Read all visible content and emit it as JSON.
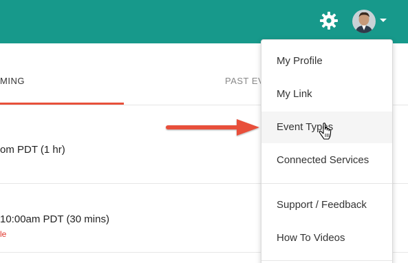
{
  "header": {
    "bg_color": "#17998b",
    "gear_icon": "gear-icon",
    "avatar": "user-avatar",
    "caret_icon": "caret-down-icon"
  },
  "tabs": {
    "upcoming_label": "MING",
    "past_label": "PAST EV",
    "active_underline_color": "#e8503a"
  },
  "events": [
    {
      "time": "om PDT (1 hr)"
    },
    {
      "time": "10:00am PDT (30 mins)",
      "sub": "le"
    }
  ],
  "menu": {
    "items": [
      {
        "label": "My Profile"
      },
      {
        "label": "My Link"
      },
      {
        "label": "Event Types"
      },
      {
        "label": "Connected Services"
      },
      {
        "label": "Support / Feedback"
      },
      {
        "label": "How To Videos"
      }
    ],
    "hovered_item": "Event Types"
  },
  "annotation": {
    "arrow_color": "#e8503a",
    "cursor_icon": "hand-pointer-icon"
  }
}
